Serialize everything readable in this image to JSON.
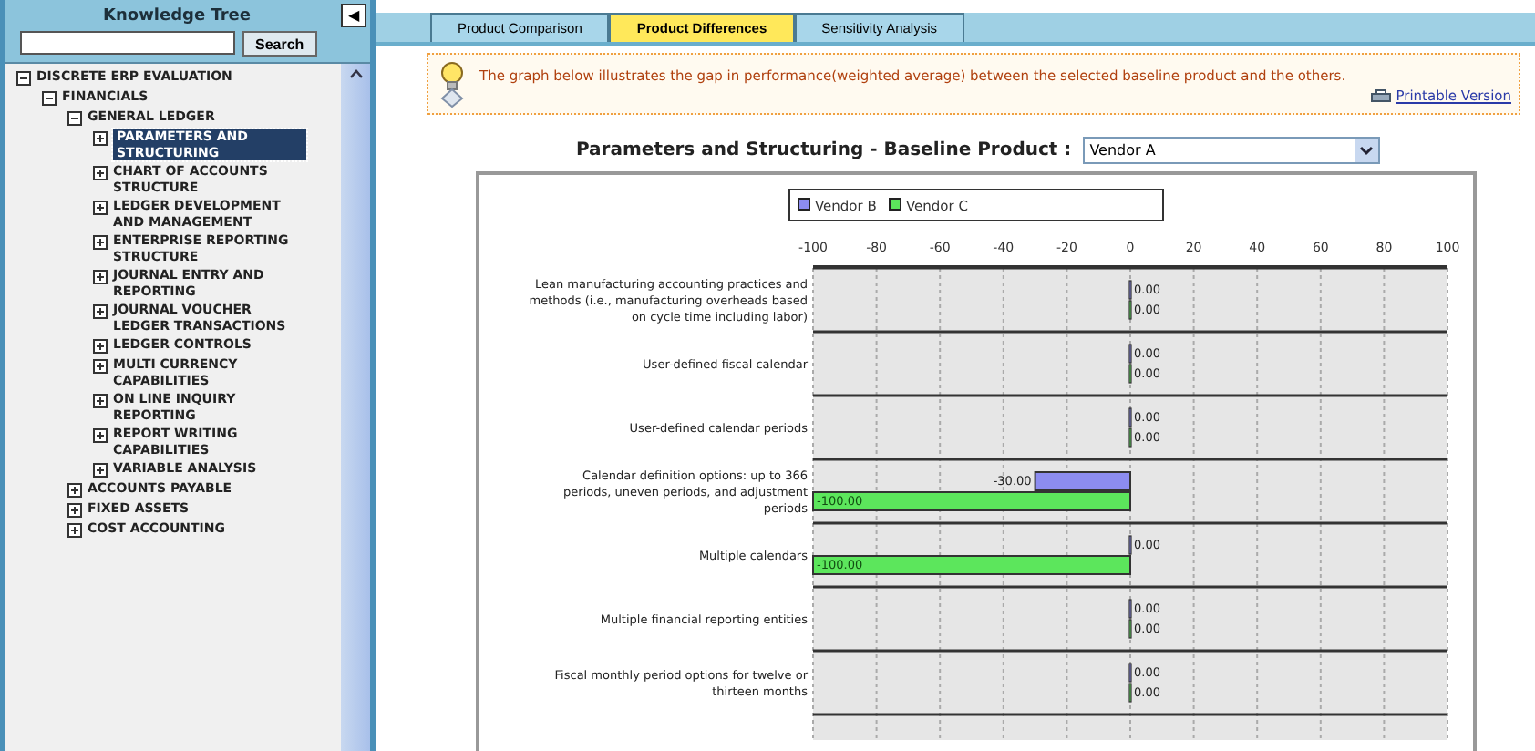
{
  "sidebar": {
    "title": "Knowledge Tree",
    "collapse_button": "◀",
    "search": {
      "button": "Search"
    },
    "tree": [
      {
        "label": "DISCRETE ERP EVALUATION",
        "expanded": true,
        "selected": false,
        "children": [
          {
            "label": "FINANCIALS",
            "expanded": true,
            "selected": false,
            "children": [
              {
                "label": "GENERAL LEDGER",
                "expanded": true,
                "selected": false,
                "children": [
                  {
                    "label": "PARAMETERS AND STRUCTURING",
                    "expanded": false,
                    "selected": true
                  },
                  {
                    "label": "CHART OF ACCOUNTS STRUCTURE",
                    "expanded": false,
                    "selected": false
                  },
                  {
                    "label": "LEDGER DEVELOPMENT AND MANAGEMENT",
                    "expanded": false,
                    "selected": false
                  },
                  {
                    "label": "ENTERPRISE REPORTING STRUCTURE",
                    "expanded": false,
                    "selected": false
                  },
                  {
                    "label": "JOURNAL ENTRY AND REPORTING",
                    "expanded": false,
                    "selected": false
                  },
                  {
                    "label": "JOURNAL VOUCHER LEDGER TRANSACTIONS",
                    "expanded": false,
                    "selected": false
                  },
                  {
                    "label": "LEDGER CONTROLS",
                    "expanded": false,
                    "selected": false
                  },
                  {
                    "label": "MULTI CURRENCY CAPABILITIES",
                    "expanded": false,
                    "selected": false
                  },
                  {
                    "label": "ON LINE INQUIRY REPORTING",
                    "expanded": false,
                    "selected": false
                  },
                  {
                    "label": "REPORT WRITING CAPABILITIES",
                    "expanded": false,
                    "selected": false
                  },
                  {
                    "label": "VARIABLE ANALYSIS",
                    "expanded": false,
                    "selected": false
                  }
                ]
              },
              {
                "label": "ACCOUNTS PAYABLE",
                "expanded": false,
                "selected": false
              },
              {
                "label": "FIXED ASSETS",
                "expanded": false,
                "selected": false
              },
              {
                "label": "COST ACCOUNTING",
                "expanded": false,
                "selected": false
              }
            ]
          }
        ]
      }
    ]
  },
  "tabs": [
    {
      "label": "Product Comparison",
      "selected": false
    },
    {
      "label": "Product Differences",
      "selected": true
    },
    {
      "label": "Sensitivity Analysis",
      "selected": false
    }
  ],
  "notice": {
    "text": "The graph below illustrates the gap in performance(weighted average) between the selected baseline product and the others.",
    "link": "Printable Version"
  },
  "heading": {
    "label": "Parameters and Structuring - Baseline Product :",
    "select_value": "Vendor A"
  },
  "chart_data": {
    "type": "bar",
    "orientation": "horizontal",
    "grid": true,
    "legend": true,
    "value_labels": [
      [
        "0.00",
        "0.00",
        "0.00",
        "-30.00",
        "0.00",
        "0.00",
        "0.00"
      ],
      [
        "0.00",
        "0.00",
        "0.00",
        "-100.00",
        "-100.00",
        "0.00",
        "0.00"
      ]
    ],
    "xlim": [
      -100,
      100
    ],
    "xticks": [
      -100,
      -80,
      -60,
      -40,
      -20,
      0,
      20,
      40,
      60,
      80,
      100
    ],
    "categories": [
      "Lean manufacturing accounting practices and methods (i.e., manufacturing overheads based on cycle time including labor)",
      "User-defined fiscal calendar",
      "User-defined calendar periods",
      "Calendar definition options: up to 366 periods, uneven periods, and adjustment periods",
      "Multiple calendars",
      "Multiple financial reporting entities",
      "Fiscal monthly period options for twelve or thirteen months"
    ],
    "series": [
      {
        "name": "Vendor B",
        "color": "#8c8cf0",
        "values": [
          0,
          0,
          0,
          -30,
          0,
          0,
          0
        ]
      },
      {
        "name": "Vendor C",
        "color": "#5ce65c",
        "values": [
          0,
          0,
          0,
          -100,
          -100,
          0,
          0
        ]
      }
    ]
  }
}
